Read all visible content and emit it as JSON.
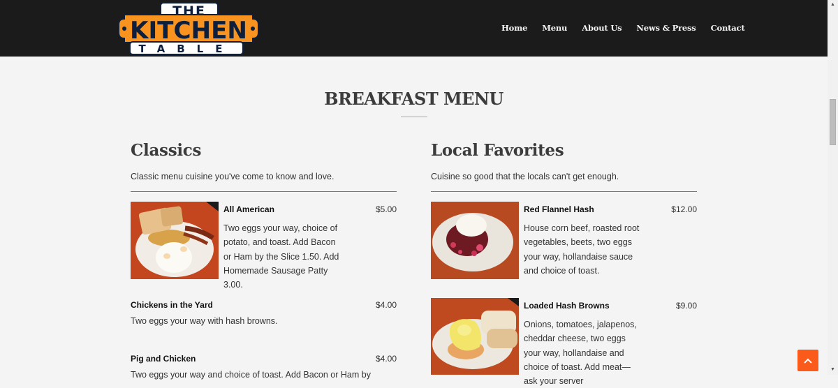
{
  "header": {
    "logo": {
      "line1": "THE",
      "line2": "KITCHEN",
      "line3": "TABLE",
      "alt": "The Kitchen Table logo"
    },
    "nav": [
      "Home",
      "Menu",
      "About Us",
      "News & Press",
      "Contact"
    ]
  },
  "page": {
    "title": "BREAKFAST MENU"
  },
  "sections": [
    {
      "heading": "Classics",
      "subtitle": "Classic menu cuisine you've come to know and love.",
      "items": [
        {
          "name": "All American",
          "price": "$5.00",
          "description": "Two eggs your way, choice of potato, and toast. Add Bacon or Ham by the Slice 1.50. Add Homemade Sausage Patty 3.00.",
          "has_photo": true
        },
        {
          "name": "Chickens in the Yard",
          "price": "$4.00",
          "description": "Two eggs your way with hash browns.",
          "has_photo": false
        },
        {
          "name": "Pig and Chicken",
          "price": "$4.00",
          "description": "Two eggs your way and choice of toast. Add Bacon or Ham by",
          "has_photo": false
        }
      ]
    },
    {
      "heading": "Local Favorites",
      "subtitle": "Cuisine so good that the locals can't get enough.",
      "items": [
        {
          "name": "Red Flannel Hash",
          "price": "$12.00",
          "description": "House corn beef, roasted root vegetables, beets, two eggs your way, hollandaise sauce and choice of toast.",
          "has_photo": true
        },
        {
          "name": "Loaded Hash Browns",
          "price": "$9.00",
          "description": "Onions, tomatoes, jalapenos, cheddar cheese, two eggs your way, hollandaise and choice of toast. Add meat—ask your server",
          "has_photo": true
        }
      ]
    }
  ],
  "back_to_top": {
    "icon": "chevron-up-icon",
    "label": "^"
  },
  "colors": {
    "header_bg": "#1b1b1b",
    "page_bg": "#f4f4f4",
    "accent_orange": "#fa5a1a",
    "logo_orange": "#f7931e",
    "logo_navy": "#0d1f3c",
    "title_rule": "#d89a72"
  }
}
